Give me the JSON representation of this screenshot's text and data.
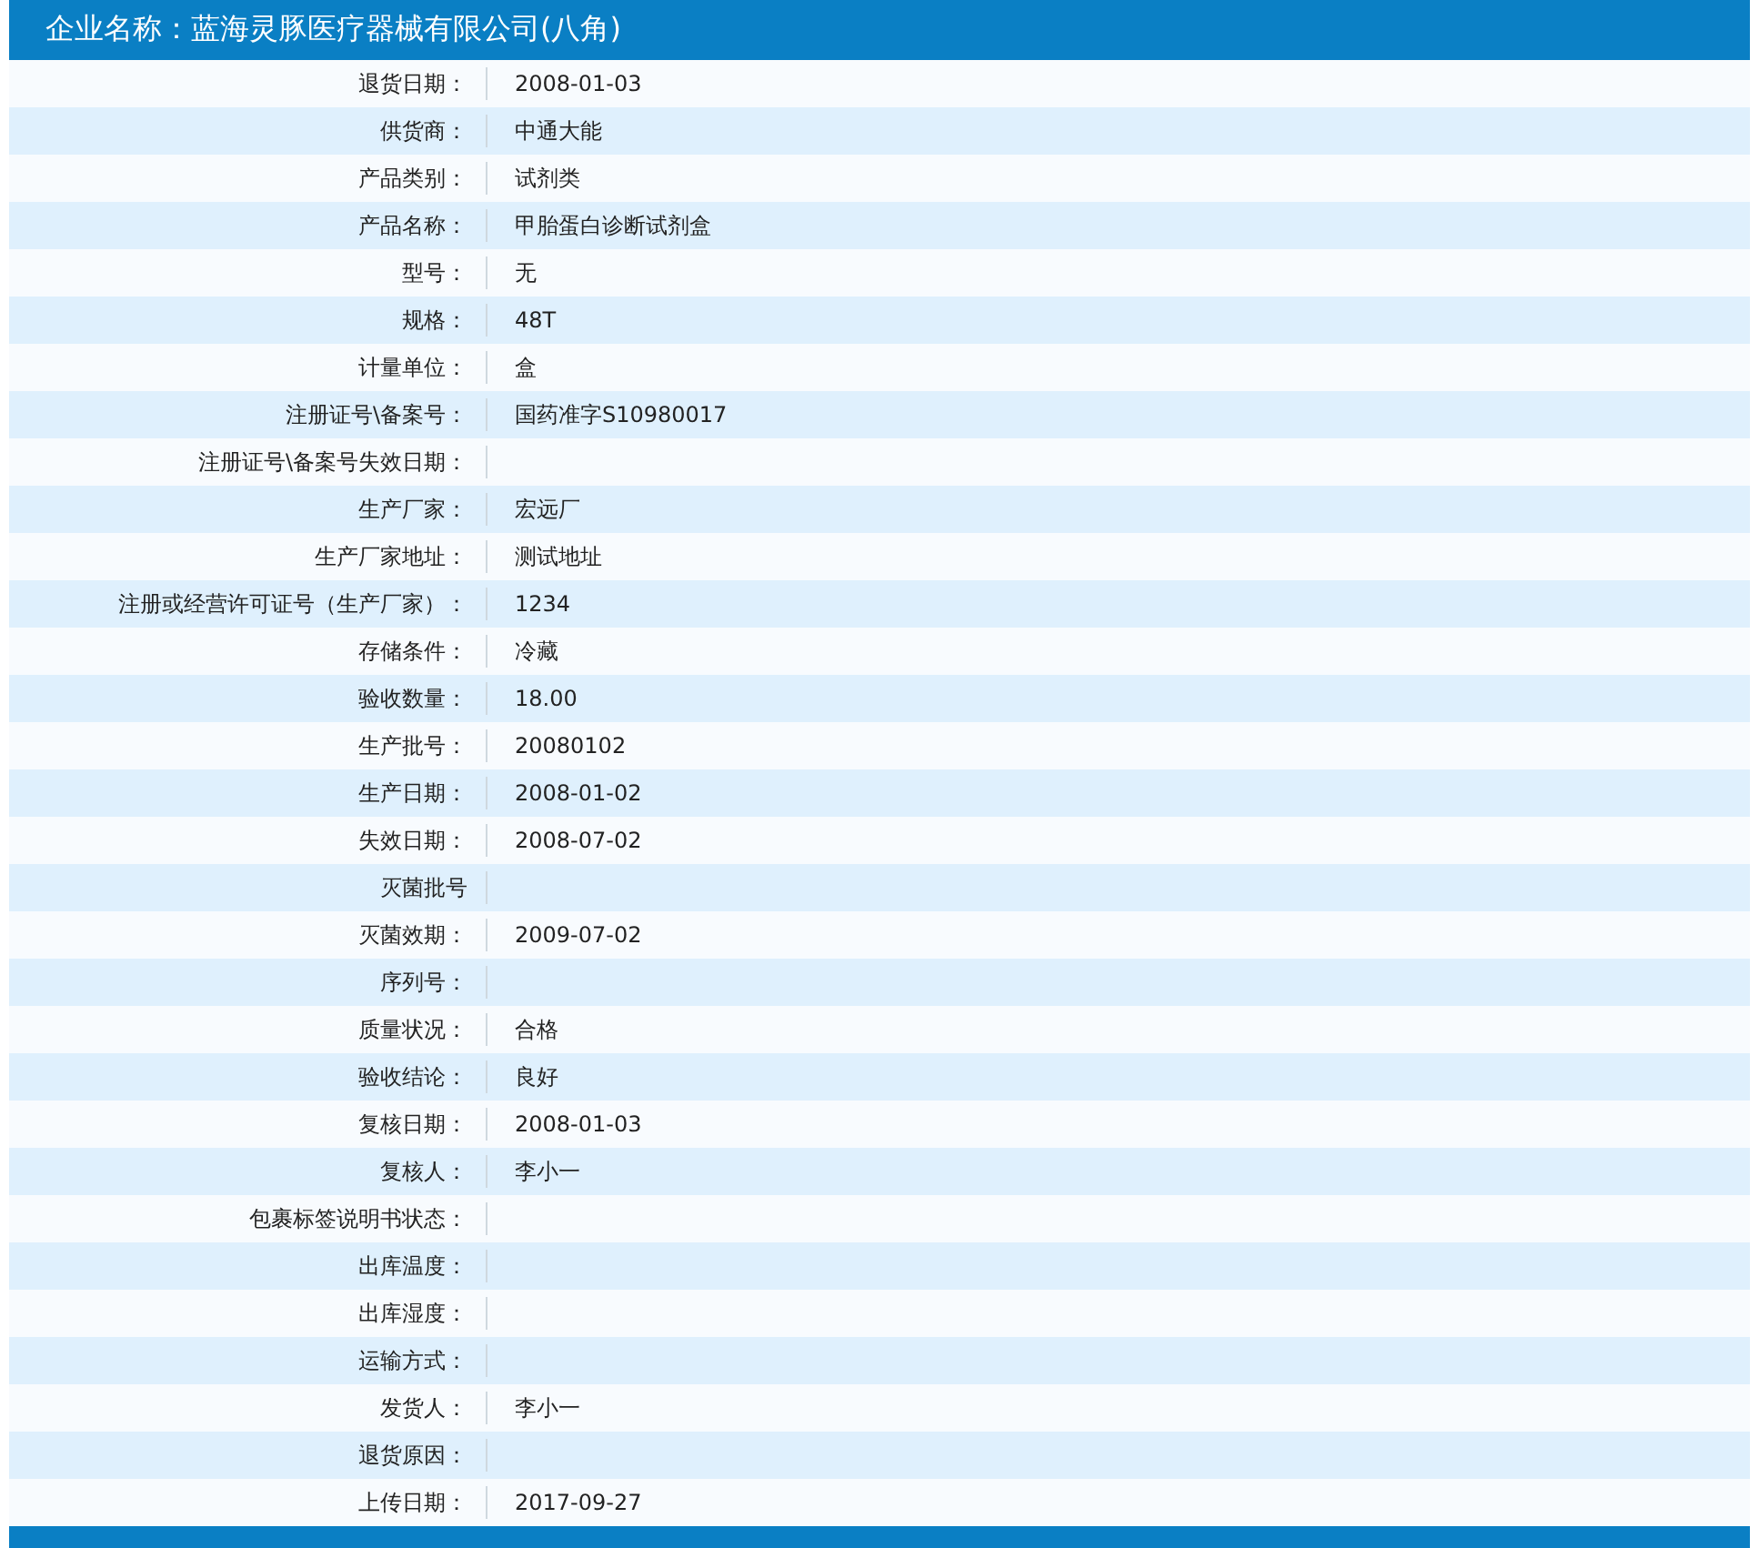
{
  "header": {
    "title": "企业名称：蓝海灵豚医疗器械有限公司(八角)"
  },
  "rows": [
    {
      "label": "退货日期：",
      "value": "2008-01-03"
    },
    {
      "label": "供货商：",
      "value": "中通大能"
    },
    {
      "label": "产品类别：",
      "value": "试剂类"
    },
    {
      "label": "产品名称：",
      "value": "甲胎蛋白诊断试剂盒"
    },
    {
      "label": "型号：",
      "value": "无"
    },
    {
      "label": "规格：",
      "value": "48T"
    },
    {
      "label": "计量单位：",
      "value": "盒"
    },
    {
      "label": "注册证号\\备案号：",
      "value": "国药准字S10980017"
    },
    {
      "label": "注册证号\\备案号失效日期："
    },
    {
      "label": "生产厂家：",
      "value": "宏远厂"
    },
    {
      "label": "生产厂家地址：",
      "value": "测试地址"
    },
    {
      "label": "注册或经营许可证号（生产厂家）：",
      "value": "1234"
    },
    {
      "label": "存储条件：",
      "value": "冷藏"
    },
    {
      "label": "验收数量：",
      "value": "18.00"
    },
    {
      "label": "生产批号：",
      "value": "20080102"
    },
    {
      "label": "生产日期：",
      "value": "2008-01-02"
    },
    {
      "label": "失效日期：",
      "value": "2008-07-02"
    },
    {
      "label": "灭菌批号"
    },
    {
      "label": "灭菌效期：",
      "value": "2009-07-02"
    },
    {
      "label": "序列号："
    },
    {
      "label": "质量状况：",
      "value": "合格"
    },
    {
      "label": "验收结论：",
      "value": "良好"
    },
    {
      "label": "复核日期：",
      "value": "2008-01-03"
    },
    {
      "label": "复核人：",
      "value": "李小一"
    },
    {
      "label": "包裹标签说明书状态："
    },
    {
      "label": "出库温度："
    },
    {
      "label": "出库湿度："
    },
    {
      "label": "运输方式："
    },
    {
      "label": "发货人：",
      "value": "李小一"
    },
    {
      "label": "退货原因："
    },
    {
      "label": "上传日期：",
      "value": "2017-09-27"
    }
  ]
}
